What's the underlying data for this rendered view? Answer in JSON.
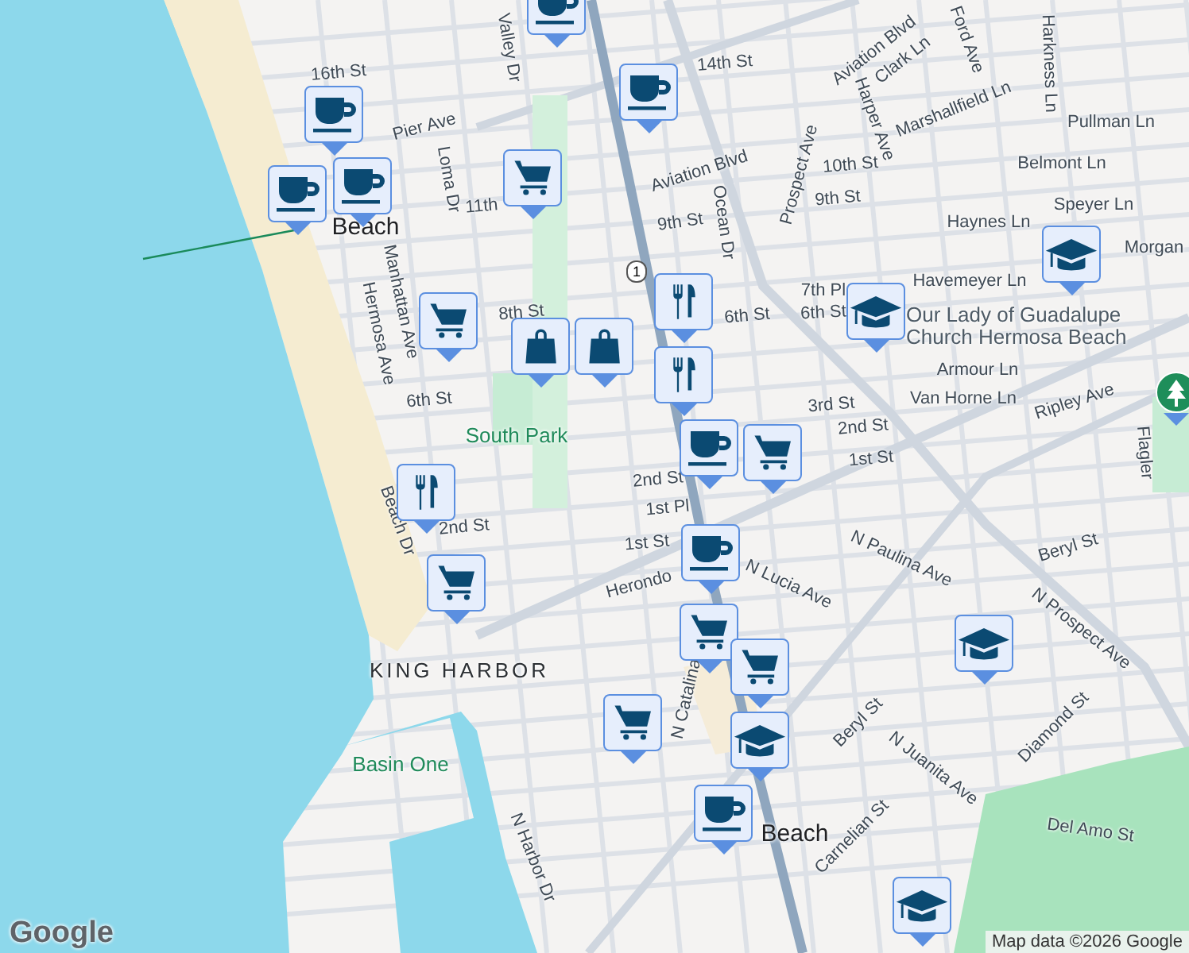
{
  "map": {
    "labels": [
      {
        "text": "16th St",
        "kind": "street"
      },
      {
        "text": "Pier Ave",
        "kind": "street"
      },
      {
        "text": "Valley Dr",
        "kind": "street"
      },
      {
        "text": "Loma Dr",
        "kind": "street"
      },
      {
        "text": "11th",
        "kind": "street"
      },
      {
        "text": "Beach",
        "kind": "place"
      },
      {
        "text": "Hermosa Ave",
        "kind": "street"
      },
      {
        "text": "Manhattan Ave",
        "kind": "street"
      },
      {
        "text": "8th St",
        "kind": "street"
      },
      {
        "text": "6th St",
        "kind": "street"
      },
      {
        "text": "South Park",
        "kind": "park"
      },
      {
        "text": "2nd St",
        "kind": "street"
      },
      {
        "text": "Beach Dr",
        "kind": "street"
      },
      {
        "text": "KING HARBOR",
        "kind": "district"
      },
      {
        "text": "Basin One",
        "kind": "park"
      },
      {
        "text": "N Harbor Dr",
        "kind": "street"
      },
      {
        "text": "14th St",
        "kind": "street"
      },
      {
        "text": "Aviation Blvd",
        "kind": "street"
      },
      {
        "text": "Clark Ln",
        "kind": "street"
      },
      {
        "text": "Ford Ave",
        "kind": "street"
      },
      {
        "text": "Harkness Ln",
        "kind": "street"
      },
      {
        "text": "Pullman Ln",
        "kind": "street"
      },
      {
        "text": "Marshallfield Ln",
        "kind": "street"
      },
      {
        "text": "Harper Ave",
        "kind": "street"
      },
      {
        "text": "Prospect Ave",
        "kind": "street"
      },
      {
        "text": "Aviation Blvd",
        "kind": "street"
      },
      {
        "text": "Ocean Dr",
        "kind": "street"
      },
      {
        "text": "10th St",
        "kind": "street"
      },
      {
        "text": "9th St",
        "kind": "street"
      },
      {
        "text": "9th St",
        "kind": "street"
      },
      {
        "text": "Belmont Ln",
        "kind": "street"
      },
      {
        "text": "Speyer Ln",
        "kind": "street"
      },
      {
        "text": "Haynes Ln",
        "kind": "street"
      },
      {
        "text": "Morgan",
        "kind": "street"
      },
      {
        "text": "Havemeyer Ln",
        "kind": "street"
      },
      {
        "text": "7th Pl",
        "kind": "street"
      },
      {
        "text": "6th St",
        "kind": "street"
      },
      {
        "text": "6th St",
        "kind": "street"
      },
      {
        "text": "Our Lady of Guadalupe Church Hermosa Beach",
        "kind": "poi"
      },
      {
        "text": "Armour Ln",
        "kind": "street"
      },
      {
        "text": "Van Horne Ln",
        "kind": "street"
      },
      {
        "text": "3rd St",
        "kind": "street"
      },
      {
        "text": "2nd St",
        "kind": "street"
      },
      {
        "text": "Ripley Ave",
        "kind": "street"
      },
      {
        "text": "Flagler",
        "kind": "street"
      },
      {
        "text": "1st St",
        "kind": "street"
      },
      {
        "text": "2nd St",
        "kind": "street"
      },
      {
        "text": "1st Pl",
        "kind": "street"
      },
      {
        "text": "1st St",
        "kind": "street"
      },
      {
        "text": "Herondo",
        "kind": "street"
      },
      {
        "text": "N Lucia Ave",
        "kind": "street"
      },
      {
        "text": "N Paulina Ave",
        "kind": "street"
      },
      {
        "text": "Beryl St",
        "kind": "street"
      },
      {
        "text": "N Prospect Ave",
        "kind": "street"
      },
      {
        "text": "N Catalina",
        "kind": "street"
      },
      {
        "text": "Beryl St",
        "kind": "street"
      },
      {
        "text": "N Juanita Ave",
        "kind": "street"
      },
      {
        "text": "Diamond St",
        "kind": "street"
      },
      {
        "text": "Del Amo St",
        "kind": "street"
      },
      {
        "text": "Carnelian St",
        "kind": "street"
      },
      {
        "text": "Beach",
        "kind": "place"
      }
    ],
    "pins": [
      {
        "kind": "cafe"
      },
      {
        "kind": "cafe"
      },
      {
        "kind": "cafe"
      },
      {
        "kind": "cart"
      },
      {
        "kind": "cafe"
      },
      {
        "kind": "cafe"
      },
      {
        "kind": "cart"
      },
      {
        "kind": "bag"
      },
      {
        "kind": "bag"
      },
      {
        "kind": "restaurant"
      },
      {
        "kind": "restaurant"
      },
      {
        "kind": "cafe"
      },
      {
        "kind": "cart"
      },
      {
        "kind": "restaurant"
      },
      {
        "kind": "cart"
      },
      {
        "kind": "cafe"
      },
      {
        "kind": "cart"
      },
      {
        "kind": "school"
      },
      {
        "kind": "school"
      },
      {
        "kind": "school"
      },
      {
        "kind": "cart"
      },
      {
        "kind": "school"
      },
      {
        "kind": "cart"
      },
      {
        "kind": "cafe"
      },
      {
        "kind": "school"
      },
      {
        "kind": "park"
      }
    ],
    "highway_shield": "1",
    "logo": "Google",
    "attribution": "Map data ©2026 Google"
  }
}
